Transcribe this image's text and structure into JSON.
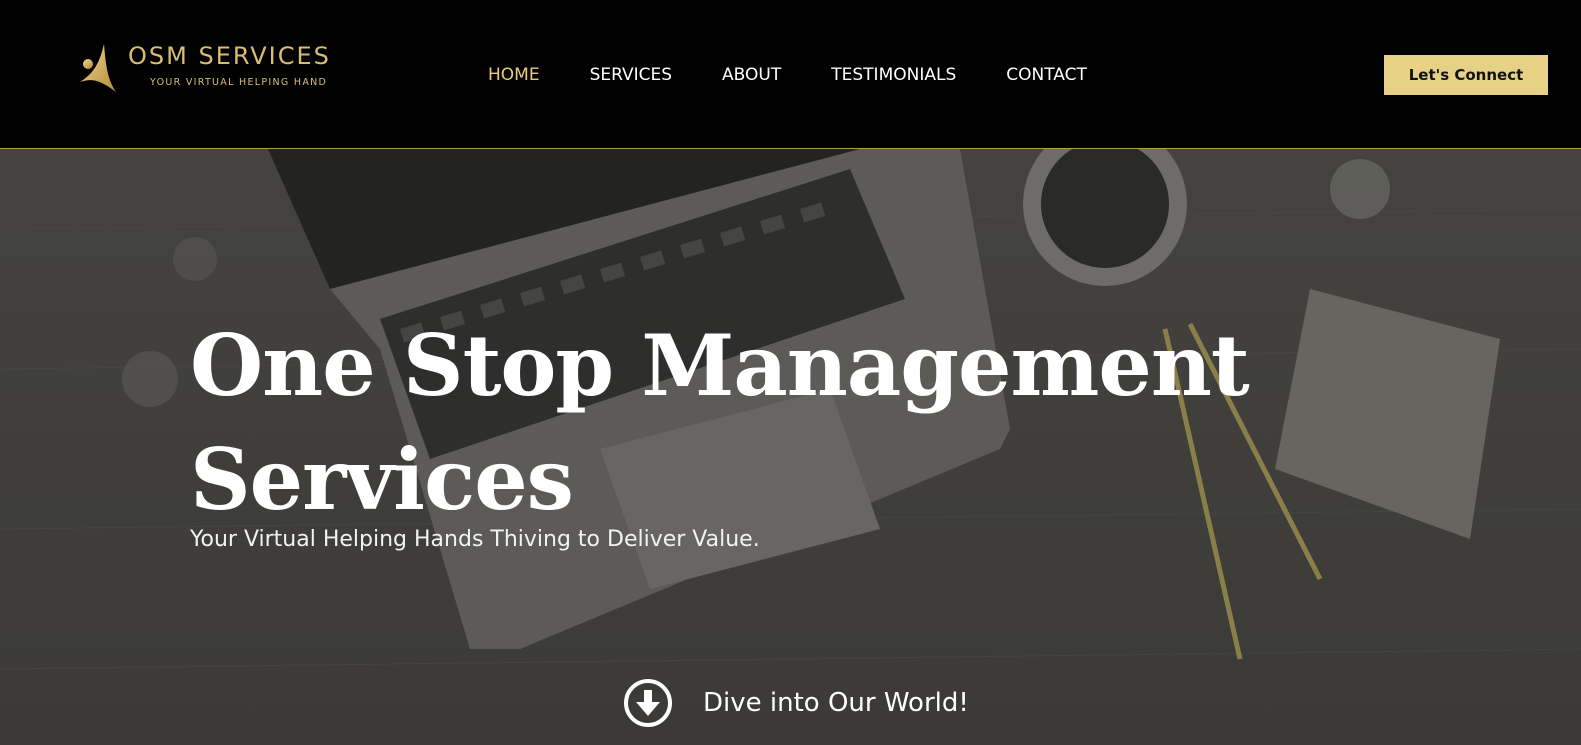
{
  "brand": {
    "name": "OSM SERVICES",
    "tagline": "YOUR VIRTUAL HELPING HAND",
    "logo_icon": "person-figure-icon",
    "accent_color": "#d9bd72"
  },
  "nav": {
    "items": [
      {
        "label": "HOME",
        "active": true
      },
      {
        "label": "SERVICES",
        "active": false
      },
      {
        "label": "ABOUT",
        "active": false
      },
      {
        "label": "TESTIMONIALS",
        "active": false
      },
      {
        "label": "CONTACT",
        "active": false
      }
    ],
    "active_color": "#e8cd80"
  },
  "header": {
    "cta_label": "Let's Connect",
    "cta_color": "#e6d184",
    "background": "#000000"
  },
  "hero": {
    "title": "One Stop Management Services",
    "subtitle": "Your Virtual Helping Hands Thiving to Deliver Value.",
    "scroll_label": "Dive into Our World!",
    "scroll_icon": "arrow-down-circle-icon",
    "background_image": "laptop-desk-photo"
  }
}
